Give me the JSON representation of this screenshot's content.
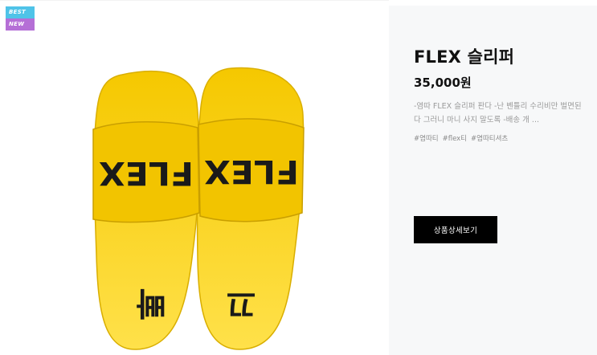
{
  "badges": {
    "best": "BEST",
    "new": "NEW"
  },
  "product": {
    "title": "FLEX 슬리퍼",
    "price": "35,000원",
    "description": "-염따 FLEX 슬리퍼 판다 -난 벤틀리 수리비만 벌면된다 그러니 마니 사지 말도록 -배송 개 ...",
    "tags": [
      "#염따티",
      "#flex티",
      "#염따티셔츠"
    ],
    "image": {
      "print_top": "FLEX",
      "print_left": "빠",
      "print_right": "끄"
    }
  },
  "actions": {
    "detail_label": "상품상세보기"
  },
  "colors": {
    "sole": "#f7d42a",
    "strap": "#f2c400",
    "info_bg": "#f7f8f9",
    "button": "#000000",
    "best_badge": "#4fc3e8",
    "new_badge": "#b56fd6"
  }
}
